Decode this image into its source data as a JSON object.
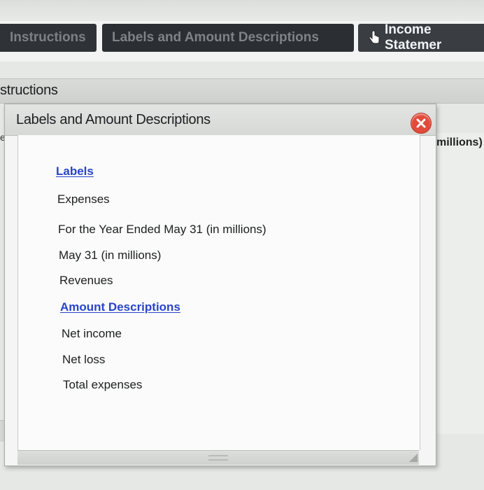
{
  "tabs": [
    {
      "label": "Instructions"
    },
    {
      "label": "Labels and Amount Descriptions"
    },
    {
      "label": "Income Statemer"
    }
  ],
  "background": {
    "section_title": "structions",
    "left_fragment": "e",
    "right_fragment": "millions)"
  },
  "dialog": {
    "title": "Labels and Amount Descriptions",
    "close_icon": "close-x-icon",
    "labels_heading": "Labels",
    "labels": [
      "Expenses",
      "For the Year Ended May 31 (in millions)",
      "May 31 (in millions)",
      "Revenues"
    ],
    "amounts_heading": "Amount Descriptions",
    "amount_descriptions": [
      "Net income",
      "Net loss",
      "Total expenses"
    ]
  },
  "colors": {
    "heading_link": "#2a44c9",
    "close_button": "#e24a3a",
    "active_tab": "#3a3e43"
  }
}
